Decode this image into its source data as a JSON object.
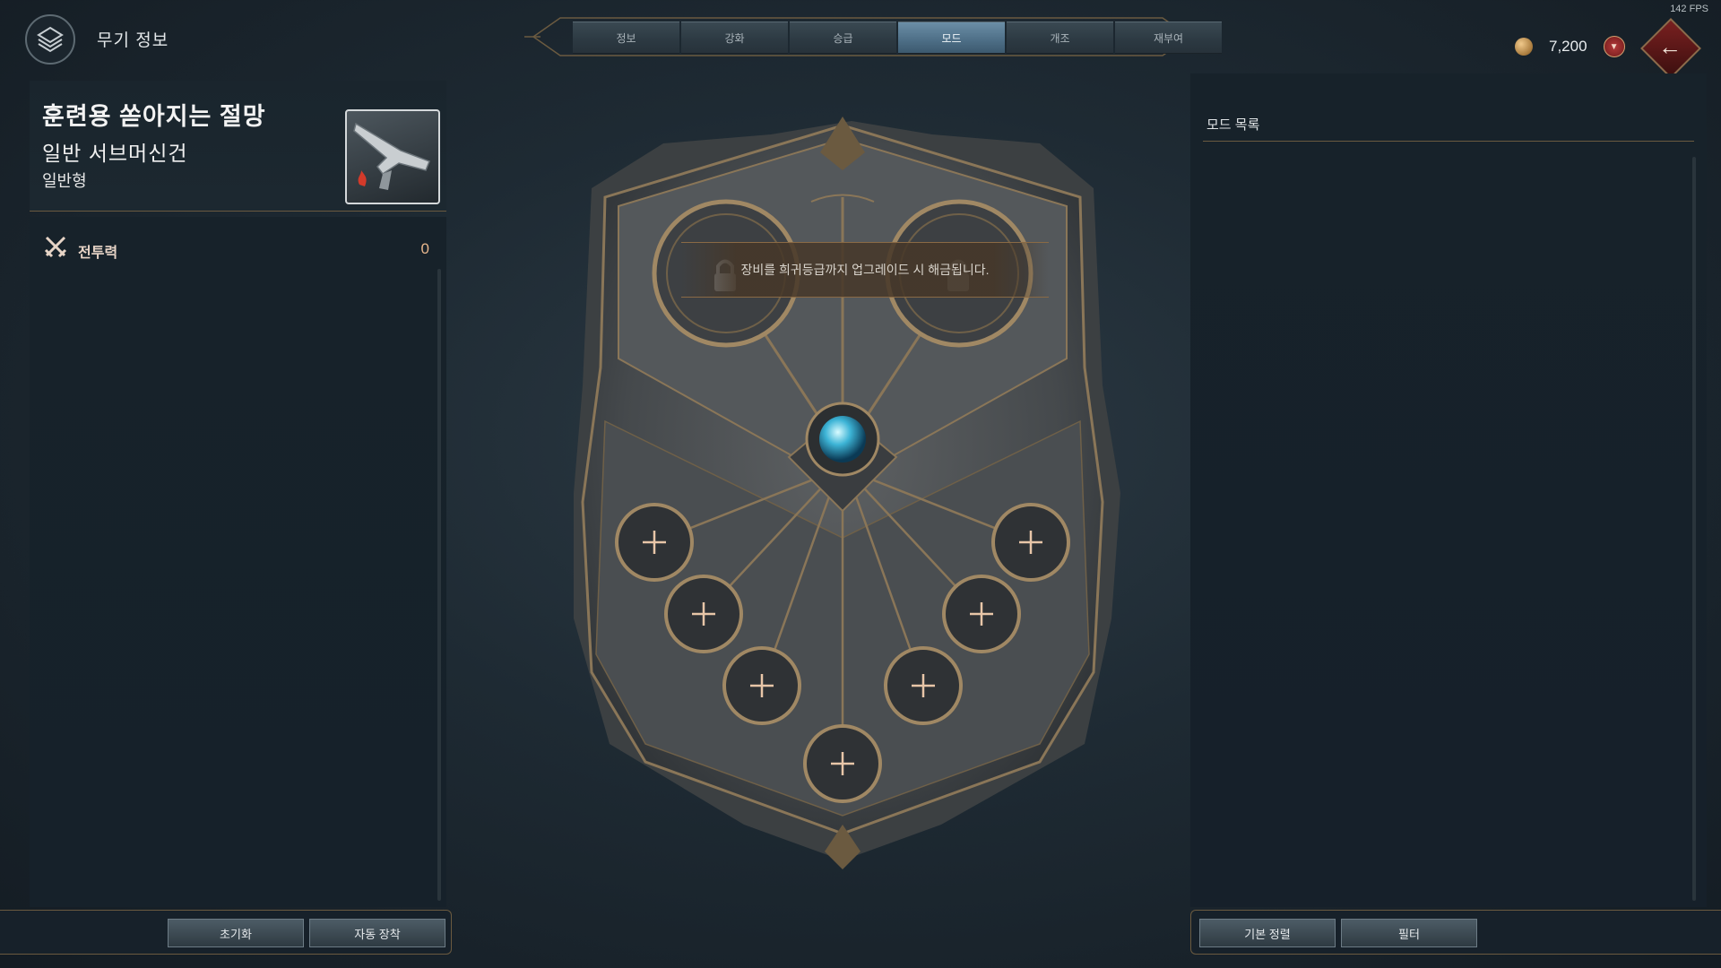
{
  "fps": "142 FPS",
  "header": {
    "title": "무기 정보"
  },
  "tabs": [
    {
      "label": "정보"
    },
    {
      "label": "강화"
    },
    {
      "label": "승급"
    },
    {
      "label": "모드"
    },
    {
      "label": "개조"
    },
    {
      "label": "재부여"
    }
  ],
  "active_tab": "모드",
  "currency": {
    "amount": "7,200"
  },
  "item": {
    "name": "훈련용 쏟아지는 절망",
    "type": "일반 서브머신건",
    "grade": "일반형"
  },
  "stats": {
    "label": "전투력",
    "value": "0"
  },
  "board": {
    "lock_message": "장비를 희귀등급까지 업그레이드 시 해금됩니다.",
    "slots": 9
  },
  "left_buttons": {
    "reset": "초기화",
    "auto_equip": "자동 장착"
  },
  "mod_list": {
    "title": "모드 목록"
  },
  "right_buttons": {
    "sort": "기본 정렬",
    "filter": "필터"
  },
  "colors": {
    "accent_tab": "#5b7f98",
    "gold_frame": "#8a6a45",
    "stat_value": "#e8b78d"
  }
}
